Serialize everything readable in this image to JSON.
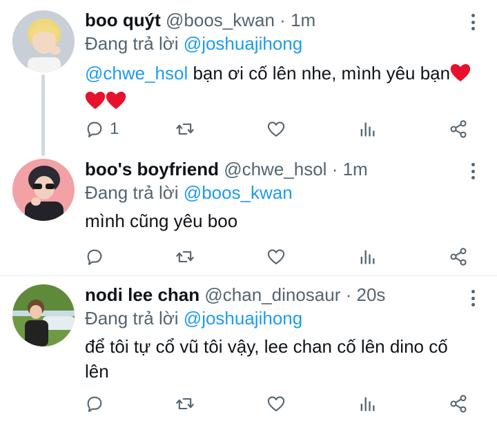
{
  "tweets": [
    {
      "name": "boo quýt",
      "handle": "@boos_kwan",
      "dot": "·",
      "time": "1m",
      "replying_prefix": "Đang trả lời",
      "replying_to": "@joshuajihong",
      "mention": "@chwe_hsol",
      "text": " bạn ơi cố lên nhe, mình yêu bạn",
      "emoji": "❤️❤️❤️",
      "reply_count": "1",
      "avatar": "avatar-boo-quyt"
    },
    {
      "name": "boo's boyfriend",
      "handle": "@chwe_hsol",
      "dot": "·",
      "time": "1m",
      "replying_prefix": "Đang trả lời",
      "replying_to": "@boos_kwan",
      "text": "mình cũng yêu boo",
      "avatar": "avatar-boos-boyfriend"
    },
    {
      "name": "nodi lee chan",
      "handle": "@chan_dinosaur",
      "dot": "·",
      "time": "20s",
      "replying_prefix": "Đang trả lời",
      "replying_to": "@joshuajihong",
      "text": "để tôi tự cổ vũ tôi vậy, lee chan cố lên dino cố lên",
      "avatar": "avatar-nodi-lee-chan"
    }
  ],
  "icons": {
    "reply": "reply-icon",
    "retweet": "retweet-icon",
    "like": "heart-icon",
    "analytics": "analytics-icon",
    "share": "share-icon",
    "more": "more-vertical-icon"
  },
  "colors": {
    "link": "#1d9bf0",
    "secondary": "#536471",
    "thread_line": "#cfd9de",
    "heart_red": "#e8112d"
  }
}
